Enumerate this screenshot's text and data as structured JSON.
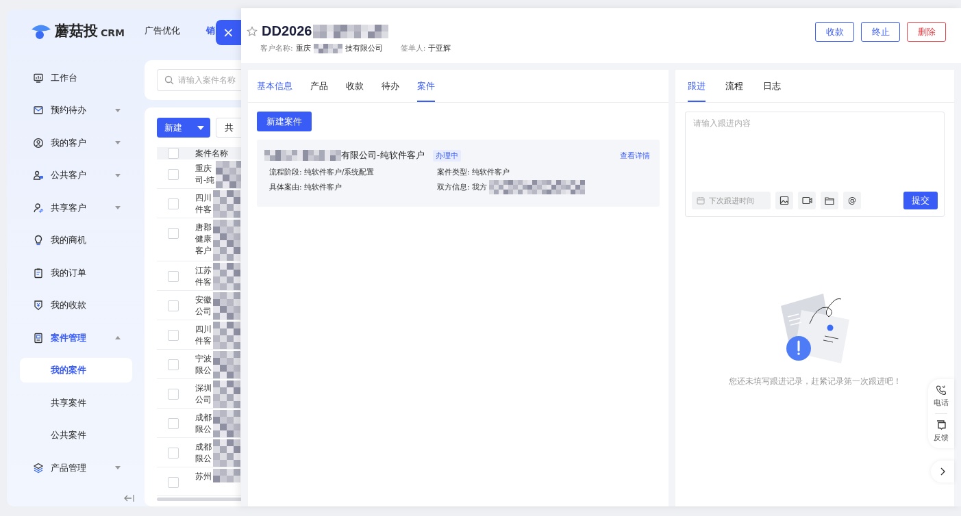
{
  "brand": {
    "name": "蘑菇投",
    "suffix": "CRM"
  },
  "top_nav": [
    {
      "label": "广告优化",
      "selected": false
    },
    {
      "label": "销",
      "selected": true
    }
  ],
  "sidebar": {
    "items": [
      {
        "label": "工作台",
        "selected": false
      },
      {
        "label": "预约待办",
        "expanded": false,
        "selected": false
      },
      {
        "label": "我的客户",
        "expanded": false,
        "selected": false
      },
      {
        "label": "公共客户",
        "expanded": false,
        "selected": false
      },
      {
        "label": "共享客户",
        "expanded": false,
        "selected": false
      },
      {
        "label": "我的商机",
        "selected": false
      },
      {
        "label": "我的订单",
        "selected": false
      },
      {
        "label": "我的收款",
        "selected": false
      },
      {
        "label": "案件管理",
        "expanded": true,
        "selected": true,
        "children": [
          {
            "label": "我的案件",
            "selected": true
          },
          {
            "label": "共享案件",
            "selected": false
          },
          {
            "label": "公共案件",
            "selected": false
          }
        ]
      },
      {
        "label": "产品管理",
        "expanded": false,
        "selected": false
      }
    ]
  },
  "search": {
    "placeholder": "请输入案件名称"
  },
  "toolbar": {
    "new_button": "新建",
    "share_button": "共"
  },
  "table": {
    "columns": [
      "案件名称"
    ],
    "all_checked": false,
    "rows": [
      {
        "name": [
          "重庆",
          "司-纯"
        ],
        "checked": false
      },
      {
        "name": [
          "四川",
          "件客"
        ],
        "checked": false
      },
      {
        "name": [
          "唐郡",
          "健康",
          "客户"
        ],
        "checked": false
      },
      {
        "name": [
          "江苏",
          "件客"
        ],
        "checked": false
      },
      {
        "name": [
          "安徽",
          "公司"
        ],
        "checked": false
      },
      {
        "name": [
          "四川",
          "件客"
        ],
        "checked": false
      },
      {
        "name": [
          "宁波",
          "限公"
        ],
        "checked": false
      },
      {
        "name": [
          "深圳",
          "公司"
        ],
        "checked": false
      },
      {
        "name": [
          "成都",
          "限公"
        ],
        "checked": false
      },
      {
        "name": [
          "成都",
          "限公"
        ],
        "checked": false
      },
      {
        "name": [
          "苏州"
        ],
        "checked": false
      }
    ]
  },
  "drawer": {
    "close_icon": "×",
    "starred": false,
    "title": "DD2026",
    "meta": [
      {
        "label": "客户名称:",
        "value_start": "重庆",
        "value_end": "技有限公司"
      },
      {
        "label": "签单人:",
        "value_start": "于亚辉"
      }
    ],
    "actions": [
      {
        "label": "收款",
        "kind": "outline"
      },
      {
        "label": "终止",
        "kind": "outline"
      },
      {
        "label": "删除",
        "kind": "danger"
      }
    ],
    "tabs": [
      {
        "label": "基本信息",
        "selected": false,
        "hovered": true
      },
      {
        "label": "产品",
        "selected": false,
        "hovered": false
      },
      {
        "label": "收款",
        "selected": false,
        "hovered": false
      },
      {
        "label": "待办",
        "selected": false,
        "hovered": false
      },
      {
        "label": "案件",
        "selected": true,
        "hovered": false
      }
    ],
    "new_case_button": "新建案件",
    "case": {
      "title": "有限公司-纯软件客户",
      "status": "办理中",
      "link": "查看详情",
      "fields": [
        {
          "label": "流程阶段:",
          "value": "纯软件客户/系统配置"
        },
        {
          "label": "案件类型:",
          "value": "纯软件客户"
        },
        {
          "label": "具体案由:",
          "value": "纯软件客户"
        },
        {
          "label": "双方信息:",
          "value": "我方"
        }
      ]
    },
    "side_tabs": [
      {
        "label": "跟进",
        "selected": true
      },
      {
        "label": "流程",
        "selected": false
      },
      {
        "label": "日志",
        "selected": false
      }
    ],
    "followup": {
      "placeholder": "请输入跟进内容",
      "date_placeholder": "下次跟进时间",
      "mention": "@",
      "submit": "提交"
    },
    "empty_text": "您还未填写跟进记录，赶紧记录第一次跟进吧！"
  },
  "float_widget": [
    {
      "label": "电话"
    },
    {
      "label": "反馈"
    }
  ]
}
